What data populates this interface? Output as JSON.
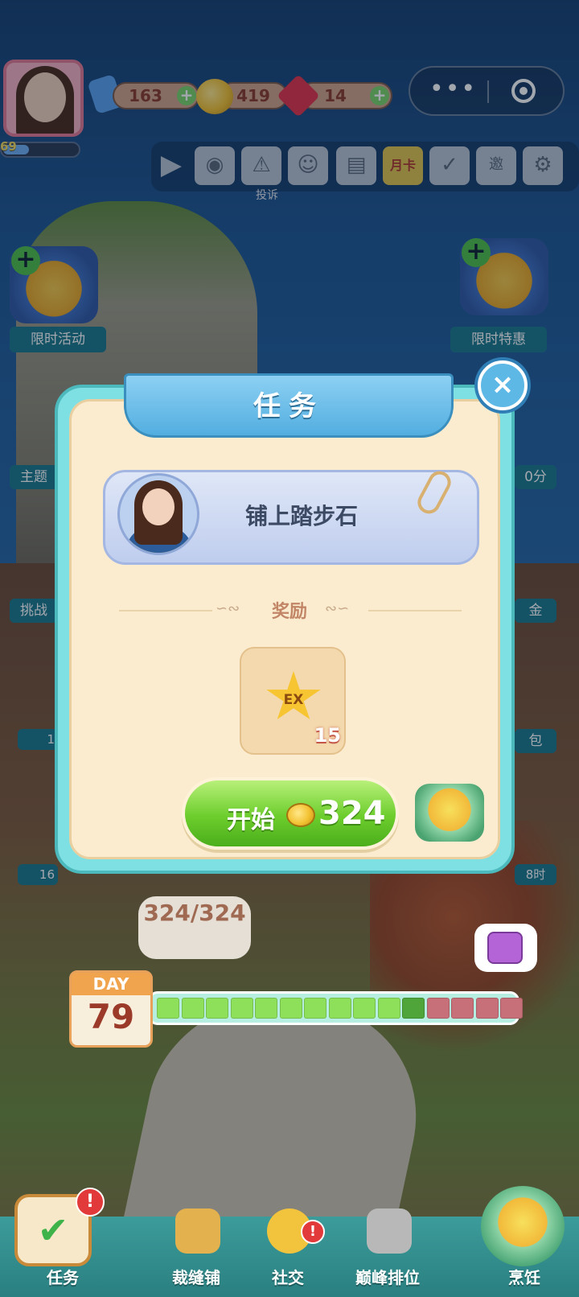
{
  "hud": {
    "level": "69",
    "level_progress": 0.35,
    "resources": [
      {
        "name": "tickets",
        "value": "163",
        "icon": "ticket-icon",
        "color": "#5aa4f0"
      },
      {
        "name": "coins",
        "value": "419",
        "icon": "coin-icon",
        "color": "#f3c232"
      },
      {
        "name": "gems",
        "value": "14",
        "icon": "ruby-icon",
        "color": "#e2334a"
      }
    ],
    "plus": "+"
  },
  "capsule": {
    "more": "•••"
  },
  "toolbar": {
    "items": [
      {
        "icon": "play-icon"
      },
      {
        "icon": "camera-icon"
      },
      {
        "icon": "complaint-icon",
        "label": "投诉"
      },
      {
        "icon": "friends-icon"
      },
      {
        "icon": "book-icon"
      },
      {
        "icon": "month-card-icon",
        "text": "月卡"
      },
      {
        "icon": "calendar-check-icon"
      },
      {
        "icon": "invite-mail-icon",
        "text": "邀"
      },
      {
        "icon": "gear-icon"
      }
    ]
  },
  "side_left": [
    {
      "label": "限时活动"
    }
  ],
  "side_right": [
    {
      "label": "限时特惠"
    }
  ],
  "side_partial": {
    "left": [
      "主题",
      "挑战",
      "1",
      "16"
    ],
    "right": [
      "0分",
      "金",
      "包",
      "8时"
    ]
  },
  "modal": {
    "title": "任务",
    "close": "×",
    "task_name": "铺上踏步石",
    "reward_label": "奖励",
    "reward": {
      "icon": "ex-star-icon",
      "text": "EX",
      "count": "15"
    },
    "start_label": "开始",
    "start_cost": "324"
  },
  "scene": {
    "progress_text": "324/324",
    "day_label": "DAY",
    "day_number": "79",
    "progress": {
      "filled": 11,
      "total": 15
    }
  },
  "bottom_nav": [
    {
      "label": "任务",
      "icon": "task-checklist-icon",
      "badge": "!"
    },
    {
      "label": "裁缝铺",
      "icon": "sewing-icon"
    },
    {
      "label": "社交",
      "icon": "social-chat-icon",
      "badge": "!"
    },
    {
      "label": "巅峰排位",
      "icon": "trophy-locked-icon"
    },
    {
      "label": "烹饪",
      "icon": "cooking-pot-icon"
    }
  ]
}
